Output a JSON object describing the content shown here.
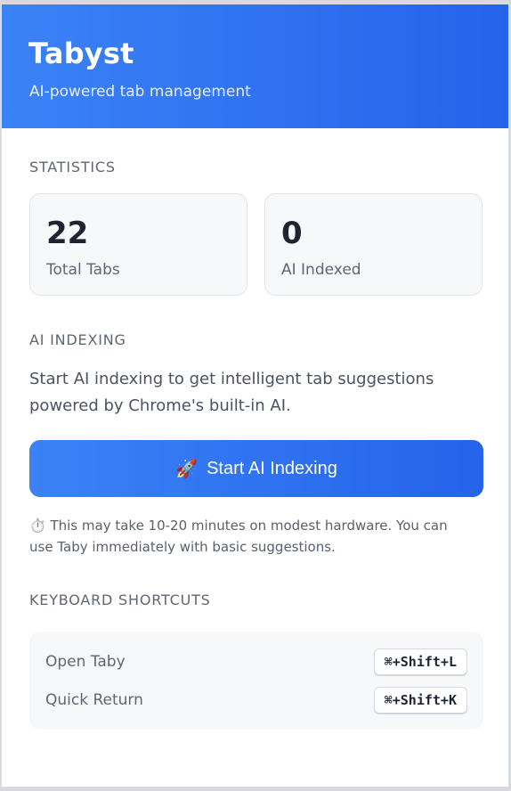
{
  "header": {
    "title": "Tabyst",
    "subtitle": "AI-powered tab management"
  },
  "statistics": {
    "section_title": "STATISTICS",
    "cards": [
      {
        "value": "22",
        "label": "Total Tabs"
      },
      {
        "value": "0",
        "label": "AI Indexed"
      }
    ]
  },
  "ai_indexing": {
    "section_title": "AI INDEXING",
    "description": "Start AI indexing to get intelligent tab suggestions powered by Chrome's built-in AI.",
    "button_icon": "🚀",
    "button_label": "Start AI Indexing",
    "note_icon": "⏱️",
    "note": "This may take 10-20 minutes on modest hardware. You can use Taby immediately with basic suggestions."
  },
  "shortcuts": {
    "section_title": "KEYBOARD SHORTCUTS",
    "items": [
      {
        "label": "Open Taby",
        "keys": "⌘+Shift+L"
      },
      {
        "label": "Quick Return",
        "keys": "⌘+Shift+K"
      }
    ]
  },
  "colors": {
    "accent": "#2563eb",
    "accent_light": "#3b82f6"
  }
}
